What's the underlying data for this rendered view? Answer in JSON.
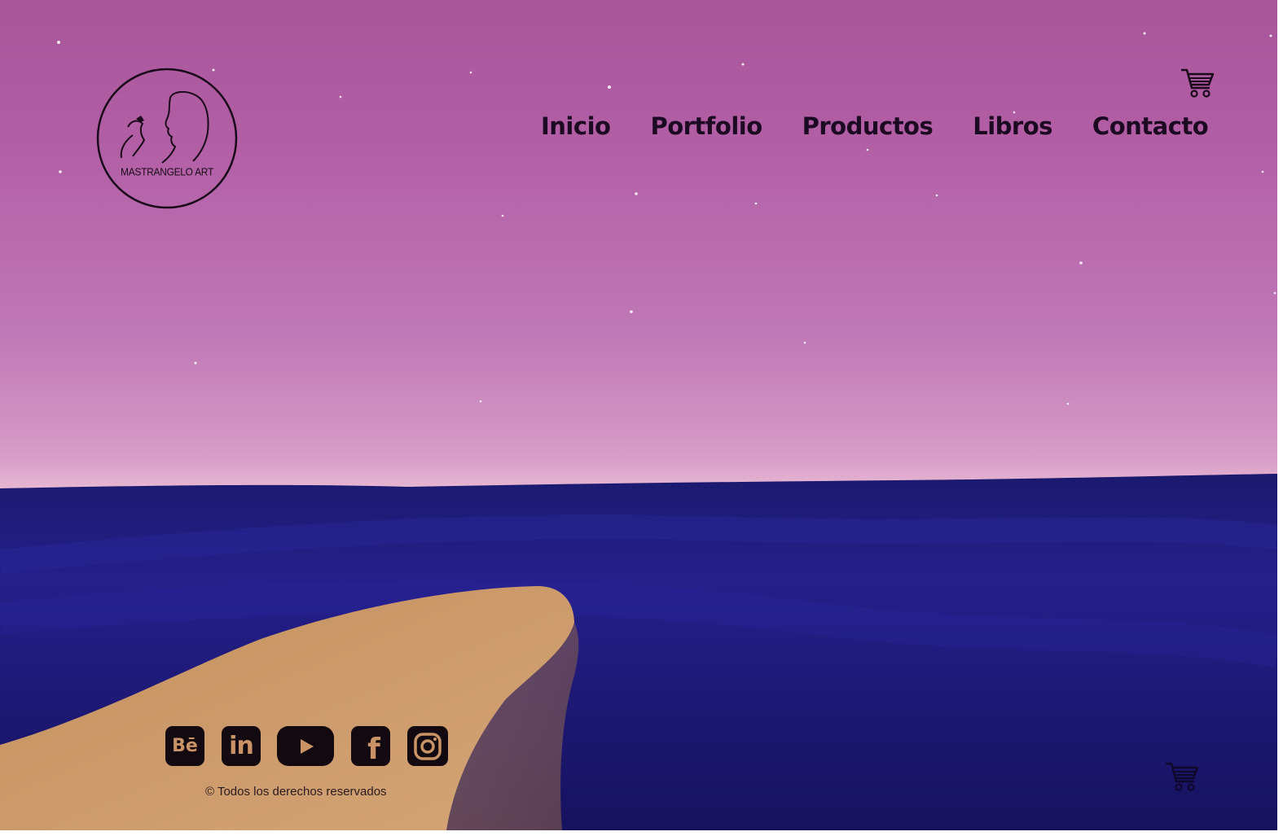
{
  "brand": {
    "logo_text": "MASTRANGELO ART"
  },
  "nav": {
    "items": [
      {
        "label": "Inicio"
      },
      {
        "label": "Portfolio"
      },
      {
        "label": "Productos"
      },
      {
        "label": "Libros"
      },
      {
        "label": "Contacto"
      }
    ]
  },
  "icons": {
    "cart": "shopping-cart-icon",
    "social": [
      "behance-icon",
      "linkedin-icon",
      "youtube-icon",
      "facebook-icon",
      "instagram-icon"
    ]
  },
  "footer": {
    "copyright": "© Todos los derechos reservados"
  },
  "colors": {
    "sky_top": "#a9559a",
    "sky_bottom": "#e7b8d3",
    "sea": "#1d1a7a",
    "sand": "#c99366",
    "text_dark": "#1b0a22"
  }
}
